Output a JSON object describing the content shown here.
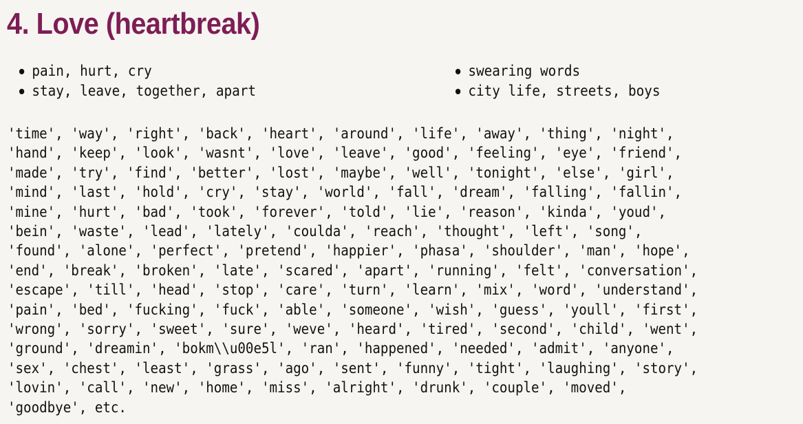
{
  "section": {
    "title": "4. Love (heartbreak)"
  },
  "bullets": {
    "left": [
      "pain, hurt, cry",
      "stay, leave, together, apart"
    ],
    "right": [
      "swearing words",
      "city life, streets, boys"
    ]
  },
  "word_list": {
    "lines": [
      "'time', 'way', 'right', 'back', 'heart', 'around', 'life', 'away', 'thing', 'night',",
      "'hand', 'keep', 'look', 'wasnt', 'love', 'leave', 'good', 'feeling', 'eye', 'friend',",
      "'made', 'try', 'find', 'better', 'lost', 'maybe', 'well', 'tonight', 'else', 'girl',",
      "'mind', 'last', 'hold', 'cry', 'stay', 'world', 'fall', 'dream', 'falling', 'fallin',",
      "'mine', 'hurt', 'bad', 'took', 'forever', 'told', 'lie', 'reason', 'kinda', 'youd',",
      "'bein', 'waste', 'lead', 'lately', 'coulda', 'reach', 'thought', 'left', 'song',",
      "'found', 'alone', 'perfect', 'pretend', 'happier', 'phasa', 'shoulder', 'man', 'hope',",
      "'end', 'break', 'broken', 'late', 'scared', 'apart', 'running', 'felt', 'conversation',",
      "'escape', 'till', 'head', 'stop', 'care', 'turn', 'learn', 'mix', 'word', 'understand',",
      "'pain', 'bed', 'fucking', 'fuck', 'able', 'someone', 'wish', 'guess', 'youll', 'first',",
      "'wrong', 'sorry', 'sweet', 'sure', 'weve', 'heard', 'tired', 'second', 'child', 'went',",
      "'ground', 'dreamin', 'bokm\\\\u00e5l', 'ran', 'happened', 'needed', 'admit', 'anyone',",
      "'sex', 'chest', 'least', 'grass', 'ago', 'sent', 'funny', 'tight', 'laughing', 'story',",
      "'lovin', 'call', 'new', 'home', 'miss', 'alright', 'drunk', 'couple', 'moved',",
      "'goodbye', etc."
    ]
  },
  "colors": {
    "title": "#7d1d55",
    "text": "#111111",
    "background": "#f7f5f2"
  }
}
